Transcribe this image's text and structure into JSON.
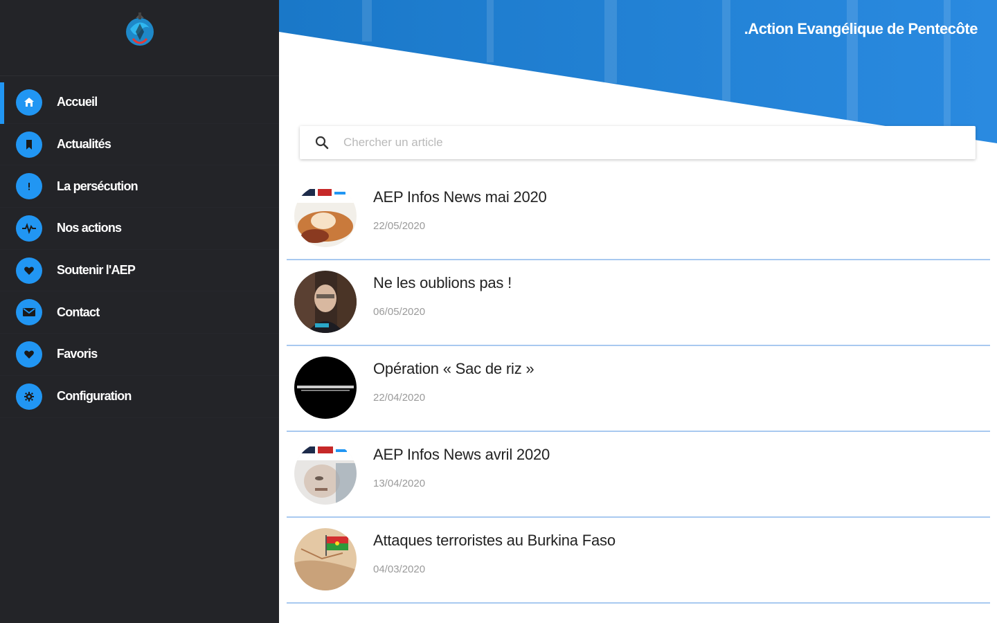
{
  "app": {
    "title": ".Action Evangélique de Pentecôte",
    "accent_color": "#2196f3",
    "sidebar_bg": "#232428"
  },
  "sidebar": {
    "items": [
      {
        "label": "Accueil",
        "icon": "home-icon",
        "active": true
      },
      {
        "label": "Actualités",
        "icon": "bookmark-icon",
        "active": false
      },
      {
        "label": "La persécution",
        "icon": "alert-icon",
        "active": false
      },
      {
        "label": "Nos actions",
        "icon": "pulse-icon",
        "active": false
      },
      {
        "label": "Soutenir l'AEP",
        "icon": "heart-icon",
        "active": false
      },
      {
        "label": "Contact",
        "icon": "mail-icon",
        "active": false
      },
      {
        "label": "Favoris",
        "icon": "heart-icon",
        "active": false
      },
      {
        "label": "Configuration",
        "icon": "gear-icon",
        "active": false
      }
    ]
  },
  "search": {
    "placeholder": "Chercher un article",
    "value": ""
  },
  "articles": [
    {
      "title": "AEP Infos News mai 2020",
      "date": "22/05/2020"
    },
    {
      "title": "Ne les oublions pas !",
      "date": "06/05/2020"
    },
    {
      "title": "Opération « Sac de riz »",
      "date": "22/04/2020"
    },
    {
      "title": "AEP Infos News avril 2020",
      "date": "13/04/2020"
    },
    {
      "title": "Attaques terroristes au Burkina Faso",
      "date": "04/03/2020"
    }
  ]
}
